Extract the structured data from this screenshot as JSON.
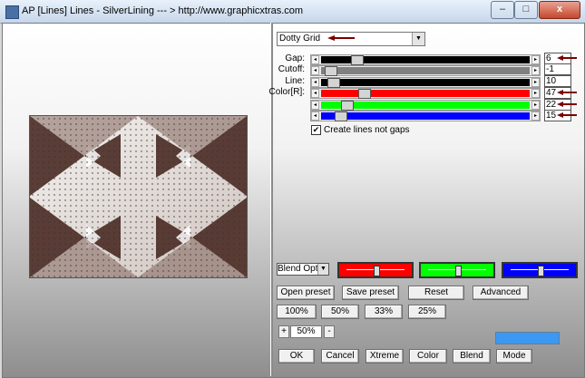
{
  "window": {
    "title": "AP [Lines]  Lines - SilverLining     --- > http://www.graphicxtras.com",
    "controls": {
      "minimize": "–",
      "maximize": "□",
      "close": "x"
    }
  },
  "effect_combo": {
    "value": "Dotty Grid"
  },
  "sliders": [
    {
      "label": "Gap:",
      "value": "6",
      "level_fraction": 0.15,
      "track_color": "#000000"
    },
    {
      "label": "Cutoff:",
      "value": "-1",
      "level_fraction": 0.02,
      "track_color": "#808080"
    },
    {
      "label": "Line:",
      "value": "10",
      "level_fraction": 0.03,
      "track_color": "#000000"
    },
    {
      "label": "Color[R]:",
      "value": "47",
      "level_fraction": 0.19,
      "track_color": "#ff0000"
    },
    {
      "label": "",
      "value": "22",
      "level_fraction": 0.1,
      "track_color": "#00ff00"
    },
    {
      "label": "",
      "value": "15",
      "level_fraction": 0.07,
      "track_color": "#0000ff"
    }
  ],
  "checkbox": {
    "label": "Create lines not gaps",
    "checked": true,
    "mark": "✔"
  },
  "blend_combo": {
    "value": "Blend Opti"
  },
  "channel_sliders": [
    {
      "color": "#ff0000",
      "level_fraction": 0.5
    },
    {
      "color": "#00ff00",
      "level_fraction": 0.5
    },
    {
      "color": "#0000ff",
      "level_fraction": 0.5
    }
  ],
  "preset_buttons": {
    "open": "Open preset",
    "save": "Save preset",
    "reset": "Reset",
    "advanced": "Advanced"
  },
  "zoom_buttons": [
    "100%",
    "50%",
    "33%",
    "25%"
  ],
  "zoom": {
    "plus": "+",
    "value": "50%",
    "minus": "-"
  },
  "color_swatch": {
    "color": "#3c98f0"
  },
  "bottom_buttons": {
    "ok": "OK",
    "cancel": "Cancel",
    "xtreme": "Xtreme",
    "color": "Color",
    "blend": "Blend",
    "mode": "Mode"
  },
  "annotation": {
    "arrow_color": "#7a0000"
  }
}
